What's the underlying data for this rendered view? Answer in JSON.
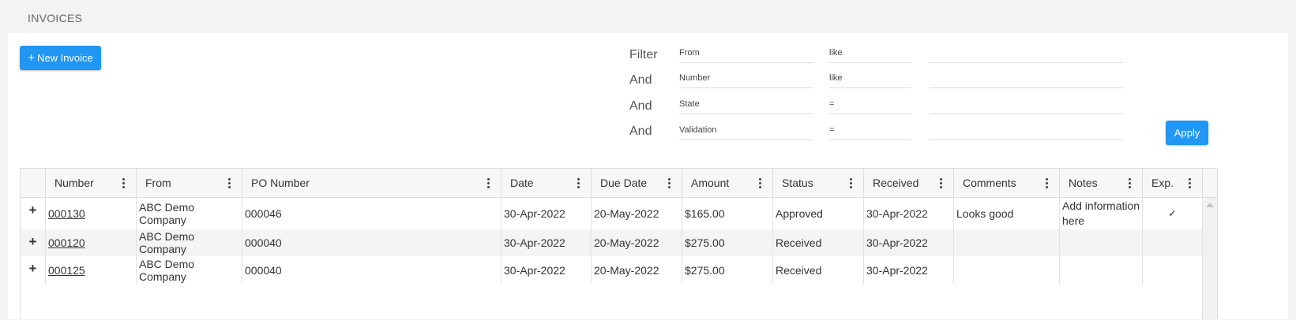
{
  "page": {
    "title": "INVOICES"
  },
  "toolbar": {
    "new_invoice_plus": "+",
    "new_invoice_label": "New Invoice",
    "apply_label": "Apply"
  },
  "filter": {
    "rows": [
      {
        "label": "Filter",
        "column": "From",
        "operator": "like",
        "value": ""
      },
      {
        "label": "And",
        "column": "Number",
        "operator": "like",
        "value": ""
      },
      {
        "label": "And",
        "column": "State",
        "operator": "=",
        "value": ""
      },
      {
        "label": "And",
        "column": "Validation",
        "operator": "=",
        "value": ""
      }
    ]
  },
  "grid": {
    "columns": [
      "Number",
      "From",
      "PO Number",
      "Date",
      "Due Date",
      "Amount",
      "Status",
      "Received",
      "Comments",
      "Notes",
      "Exp."
    ],
    "expand_glyph": "+",
    "rows": [
      {
        "number": "000130",
        "from": "ABC Demo Company",
        "po": "000046",
        "date": "30-Apr-2022",
        "due": "20-May-2022",
        "amount": "$165.00",
        "status": "Approved",
        "received": "30-Apr-2022",
        "comments": "Looks good",
        "notes": "Add information here",
        "exp": "✓"
      },
      {
        "number": "000120",
        "from": "ABC Demo Company",
        "po": "000040",
        "date": "30-Apr-2022",
        "due": "20-May-2022",
        "amount": "$275.00",
        "status": "Received",
        "received": "30-Apr-2022",
        "comments": "",
        "notes": "",
        "exp": ""
      },
      {
        "number": "000125",
        "from": "ABC Demo Company",
        "po": "000040",
        "date": "30-Apr-2022",
        "due": "20-May-2022",
        "amount": "$275.00",
        "status": "Received",
        "received": "30-Apr-2022",
        "comments": "",
        "notes": "",
        "exp": ""
      }
    ]
  },
  "colors": {
    "primary": "#2196f3",
    "row_alt": "#f4f4f4",
    "header_bg": "#f7f7f7"
  }
}
